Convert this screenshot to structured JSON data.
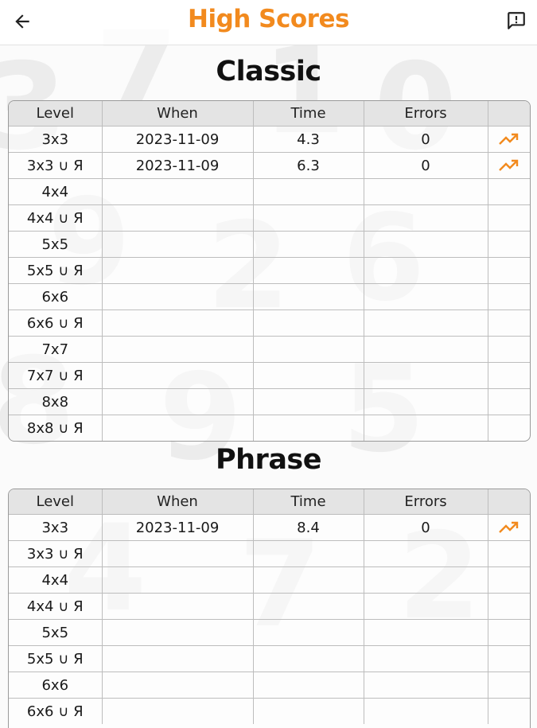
{
  "header": {
    "title": "High Scores",
    "back_icon": "arrow-left-icon",
    "feedback_icon": "feedback-icon",
    "accent_color": "#f28a1e"
  },
  "columns": [
    "Level",
    "When",
    "Time",
    "Errors",
    ""
  ],
  "sections": [
    {
      "title": "Classic",
      "rows": [
        {
          "level": "3x3",
          "when": "2023-11-09",
          "time": "4.3",
          "errors": "0",
          "trend": true
        },
        {
          "level": "3x3 ∪ Я",
          "when": "2023-11-09",
          "time": "6.3",
          "errors": "0",
          "trend": true
        },
        {
          "level": "4x4",
          "when": "",
          "time": "",
          "errors": "",
          "trend": false
        },
        {
          "level": "4x4 ∪ Я",
          "when": "",
          "time": "",
          "errors": "",
          "trend": false
        },
        {
          "level": "5x5",
          "when": "",
          "time": "",
          "errors": "",
          "trend": false
        },
        {
          "level": "5x5 ∪ Я",
          "when": "",
          "time": "",
          "errors": "",
          "trend": false
        },
        {
          "level": "6x6",
          "when": "",
          "time": "",
          "errors": "",
          "trend": false
        },
        {
          "level": "6x6 ∪ Я",
          "when": "",
          "time": "",
          "errors": "",
          "trend": false
        },
        {
          "level": "7x7",
          "when": "",
          "time": "",
          "errors": "",
          "trend": false
        },
        {
          "level": "7x7 ∪ Я",
          "when": "",
          "time": "",
          "errors": "",
          "trend": false
        },
        {
          "level": "8x8",
          "when": "",
          "time": "",
          "errors": "",
          "trend": false
        },
        {
          "level": "8x8 ∪ Я",
          "when": "",
          "time": "",
          "errors": "",
          "trend": false
        }
      ]
    },
    {
      "title": "Phrase",
      "rows": [
        {
          "level": "3x3",
          "when": "2023-11-09",
          "time": "8.4",
          "errors": "0",
          "trend": true
        },
        {
          "level": "3x3 ∪ Я",
          "when": "",
          "time": "",
          "errors": "",
          "trend": false
        },
        {
          "level": "4x4",
          "when": "",
          "time": "",
          "errors": "",
          "trend": false
        },
        {
          "level": "4x4 ∪ Я",
          "when": "",
          "time": "",
          "errors": "",
          "trend": false
        },
        {
          "level": "5x5",
          "when": "",
          "time": "",
          "errors": "",
          "trend": false
        },
        {
          "level": "5x5 ∪ Я",
          "when": "",
          "time": "",
          "errors": "",
          "trend": false
        },
        {
          "level": "6x6",
          "when": "",
          "time": "",
          "errors": "",
          "trend": false
        },
        {
          "level": "6x6 ∪ Я",
          "when": "",
          "time": "",
          "errors": "",
          "trend": false
        }
      ]
    }
  ],
  "trend_icon": "trending-up-icon"
}
